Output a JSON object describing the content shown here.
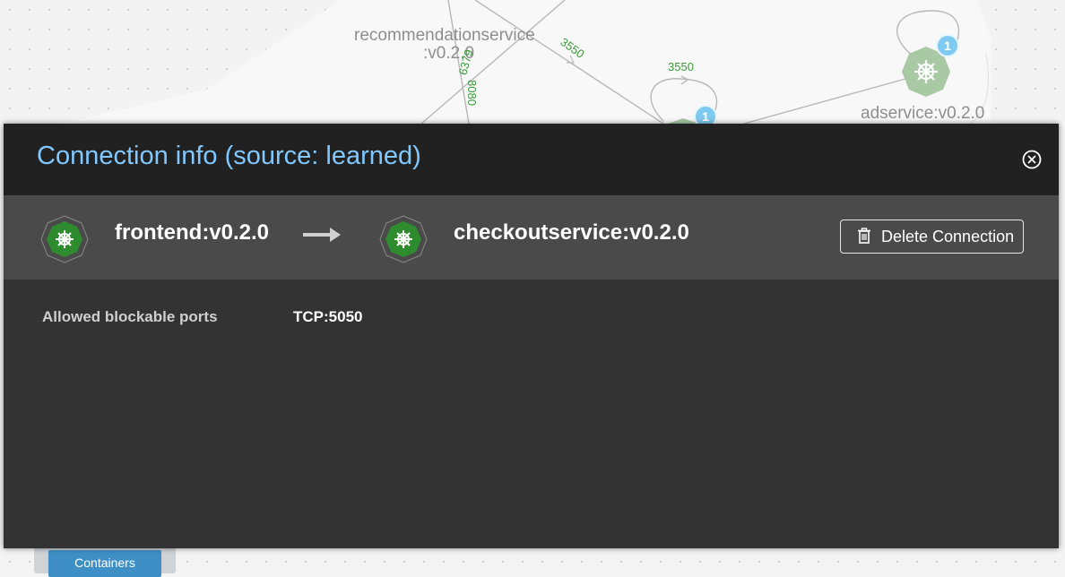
{
  "graph": {
    "nodes": [
      {
        "id": "recommendation",
        "label_line1": "recommendationservice",
        "label_line2": ":v0.2.0"
      },
      {
        "id": "adservice",
        "label": "adservice:v0.2.0",
        "badge": "1"
      },
      {
        "id": "middle",
        "badge": "1"
      }
    ],
    "ports": [
      "3550",
      "3550",
      "6379",
      "8080"
    ],
    "containers_button": "Containers"
  },
  "modal": {
    "title": "Connection info (source: learned)",
    "source_service": "frontend:v0.2.0",
    "target_service": "checkoutservice:v0.2.0",
    "delete_button": "Delete Connection",
    "fields": [
      {
        "label": "Allowed blockable ports",
        "value": "TCP:5050"
      }
    ]
  },
  "colors": {
    "title": "#80c8ff",
    "header_bg": "#212121",
    "bar_bg": "#4a4a4a",
    "body_bg": "#333333",
    "service_icon": "#2e8b2e"
  }
}
